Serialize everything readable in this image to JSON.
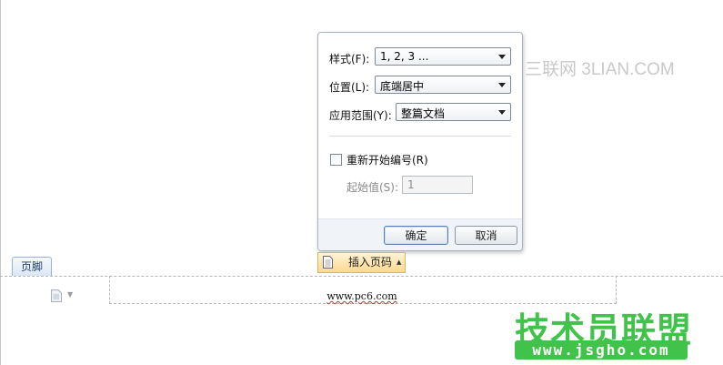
{
  "watermark": {
    "top": "三联网 3LIAN.COM",
    "brand": "技术员联盟",
    "url": "www.jsgho.com"
  },
  "dialog": {
    "style_label": "样式(F):",
    "style_value": "1, 2, 3 ...",
    "position_label": "位置(L):",
    "position_value": "底端居中",
    "scope_label": "应用范围(Y):",
    "scope_value": "整篇文档",
    "restart_label": "重新开始编号(R)",
    "restart_checked": false,
    "start_label": "起始值(S):",
    "start_value": "1",
    "ok_label": "确定",
    "cancel_label": "取消"
  },
  "document": {
    "footer_tab": "页脚",
    "insert_page_number": "插入页码",
    "footer_text": "www.pc6.com"
  }
}
